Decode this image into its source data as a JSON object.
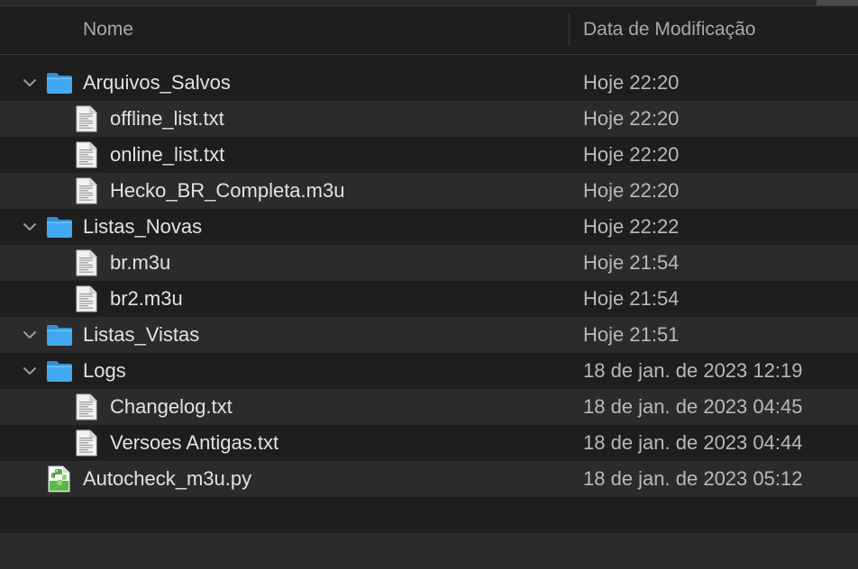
{
  "columns": {
    "name": "Nome",
    "date": "Data de Modificação"
  },
  "rows": [
    {
      "name": "Arquivos_Salvos",
      "date": "Hoje 22:20",
      "kind": "folder",
      "expanded": true,
      "level": 0
    },
    {
      "name": "offline_list.txt",
      "date": "Hoje 22:20",
      "kind": "text-file",
      "level": 1
    },
    {
      "name": "online_list.txt",
      "date": "Hoje 22:20",
      "kind": "text-file",
      "level": 1
    },
    {
      "name": "Hecko_BR_Completa.m3u",
      "date": "Hoje 22:20",
      "kind": "text-file",
      "level": 1
    },
    {
      "name": "Listas_Novas",
      "date": "Hoje 22:22",
      "kind": "folder",
      "expanded": true,
      "level": 0
    },
    {
      "name": "br.m3u",
      "date": "Hoje 21:54",
      "kind": "text-file",
      "level": 1
    },
    {
      "name": "br2.m3u",
      "date": "Hoje 21:54",
      "kind": "text-file",
      "level": 1
    },
    {
      "name": "Listas_Vistas",
      "date": "Hoje 21:51",
      "kind": "folder",
      "expanded": true,
      "level": 0
    },
    {
      "name": "Logs",
      "date": "18 de jan. de 2023 12:19",
      "kind": "folder",
      "expanded": true,
      "level": 0
    },
    {
      "name": "Changelog.txt",
      "date": "18 de jan. de 2023 04:45",
      "kind": "text-file",
      "level": 1
    },
    {
      "name": "Versoes Antigas.txt",
      "date": "18 de jan. de 2023 04:44",
      "kind": "text-file",
      "level": 1
    },
    {
      "name": "Autocheck_m3u.py",
      "date": "18 de jan. de 2023 05:12",
      "kind": "python-file",
      "level": 0
    }
  ],
  "icons": {
    "folder": "folder-icon",
    "text-file": "text-document-icon",
    "python-file": "python-script-icon",
    "disclosure": "chevron-down-icon"
  },
  "colors": {
    "background": "#1e1e1e",
    "row_alt": "#2b2b2b",
    "folder_blue": "#41a8ef",
    "text": "#e2e2e2",
    "secondary_text": "#b9b9b9"
  }
}
